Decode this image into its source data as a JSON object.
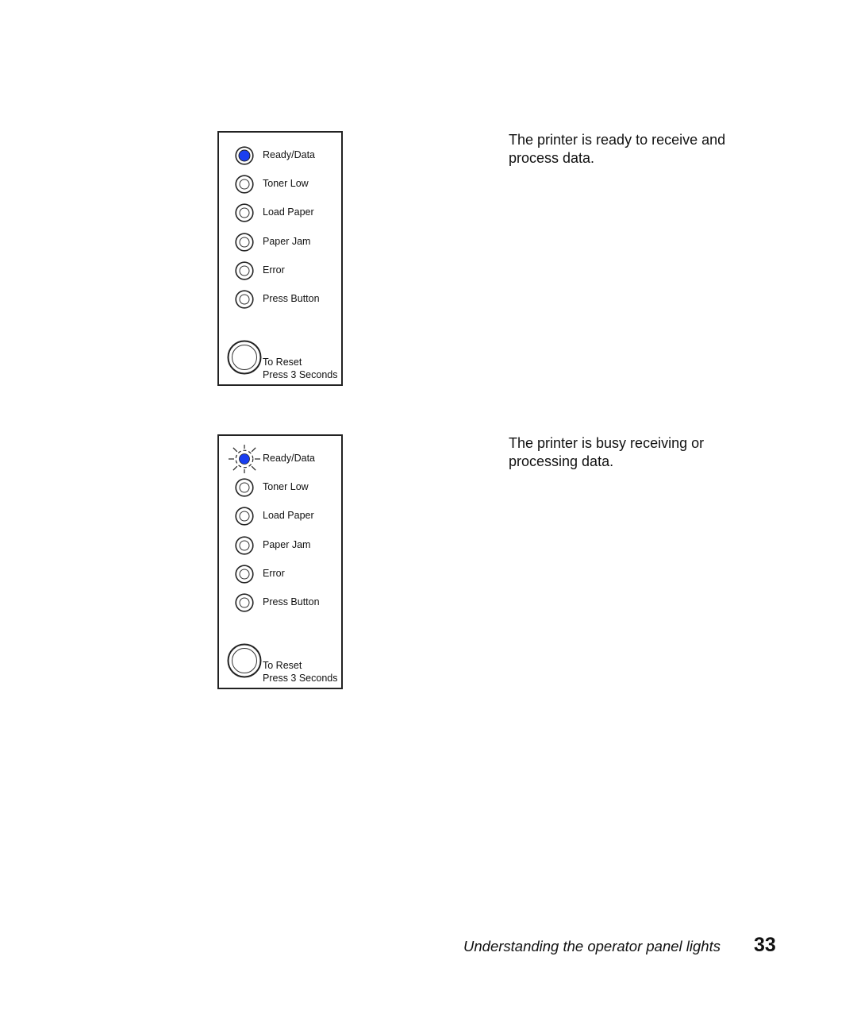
{
  "panels": [
    {
      "lights": [
        {
          "label": "Ready/Data",
          "state": "on"
        },
        {
          "label": "Toner Low",
          "state": "off"
        },
        {
          "label": "Load Paper",
          "state": "off"
        },
        {
          "label": "Paper Jam",
          "state": "off"
        },
        {
          "label": "Error",
          "state": "off"
        },
        {
          "label": "Press Button",
          "state": "off"
        }
      ],
      "reset_line1": "To Reset",
      "reset_line2": "Press 3 Seconds",
      "description": "The printer is ready to receive and process data."
    },
    {
      "lights": [
        {
          "label": "Ready/Data",
          "state": "blinking"
        },
        {
          "label": "Toner Low",
          "state": "off"
        },
        {
          "label": "Load Paper",
          "state": "off"
        },
        {
          "label": "Paper Jam",
          "state": "off"
        },
        {
          "label": "Error",
          "state": "off"
        },
        {
          "label": "Press Button",
          "state": "off"
        }
      ],
      "reset_line1": "To Reset",
      "reset_line2": "Press 3 Seconds",
      "description": "The printer is busy receiving or processing data."
    }
  ],
  "colors": {
    "led_on": "#1a3ff0",
    "outline": "#222222"
  },
  "footer": {
    "title": "Understanding the operator panel lights",
    "page_number": "33"
  }
}
